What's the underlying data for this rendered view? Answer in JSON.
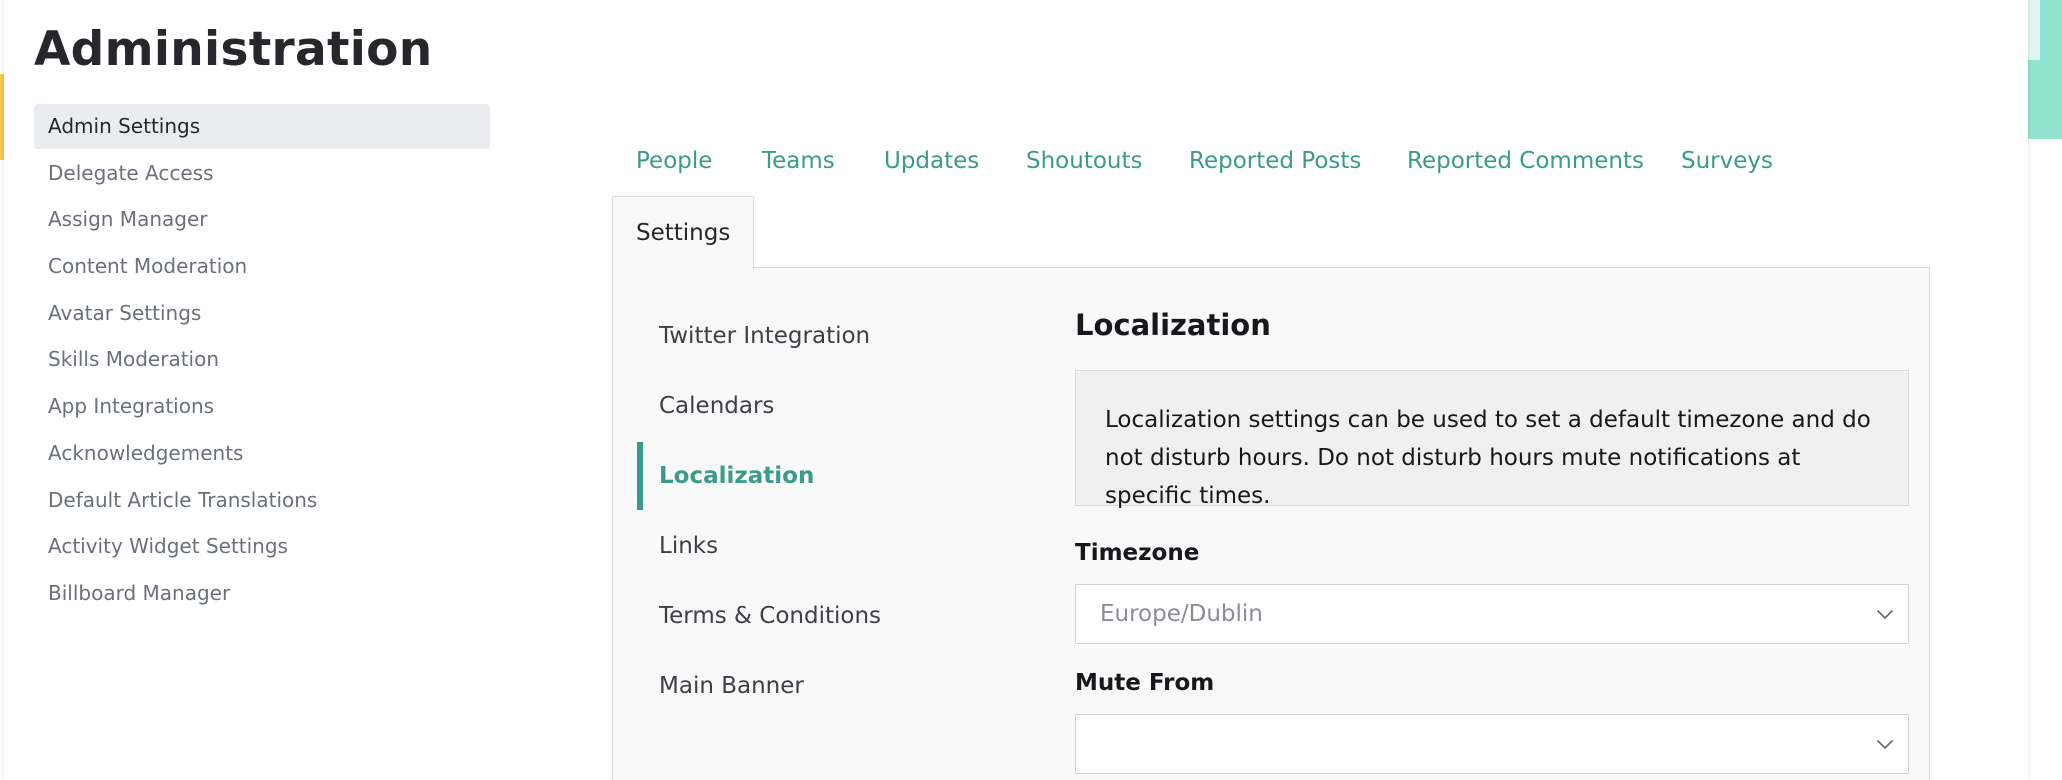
{
  "page": {
    "title": "Administration"
  },
  "admin_nav": {
    "items": [
      {
        "label": "Admin Settings",
        "active": true
      },
      {
        "label": "Delegate Access"
      },
      {
        "label": "Assign Manager"
      },
      {
        "label": "Content Moderation"
      },
      {
        "label": "Avatar Settings"
      },
      {
        "label": "Skills Moderation"
      },
      {
        "label": "App Integrations"
      },
      {
        "label": "Acknowledgements"
      },
      {
        "label": "Default Article Translations"
      },
      {
        "label": "Activity Widget Settings"
      },
      {
        "label": "Billboard Manager"
      }
    ]
  },
  "tabs": {
    "items": [
      {
        "label": "People"
      },
      {
        "label": "Teams"
      },
      {
        "label": "Updates"
      },
      {
        "label": "Shoutouts"
      },
      {
        "label": "Reported Posts"
      },
      {
        "label": "Reported Comments"
      },
      {
        "label": "Surveys"
      },
      {
        "label": "Settings",
        "active": true
      }
    ]
  },
  "settings_nav": {
    "items": [
      {
        "label": "Twitter Integration"
      },
      {
        "label": "Calendars"
      },
      {
        "label": "Localization",
        "active": true
      },
      {
        "label": "Links"
      },
      {
        "label": "Terms & Conditions"
      },
      {
        "label": "Main Banner"
      }
    ]
  },
  "localization": {
    "title": "Localization",
    "description": "Localization settings can be used to set a default timezone and do not disturb hours. Do not disturb hours mute notifications at specific times.",
    "timezone": {
      "label": "Timezone",
      "value": "Europe/Dublin"
    },
    "mute_from": {
      "label": "Mute From",
      "value": ""
    }
  },
  "colors": {
    "accent": "#3a9b8a",
    "text": "#25272b",
    "muted_text": "#6b7079",
    "active_nav_bg": "#ebecef",
    "panel_bg": "#f9f9f9"
  }
}
